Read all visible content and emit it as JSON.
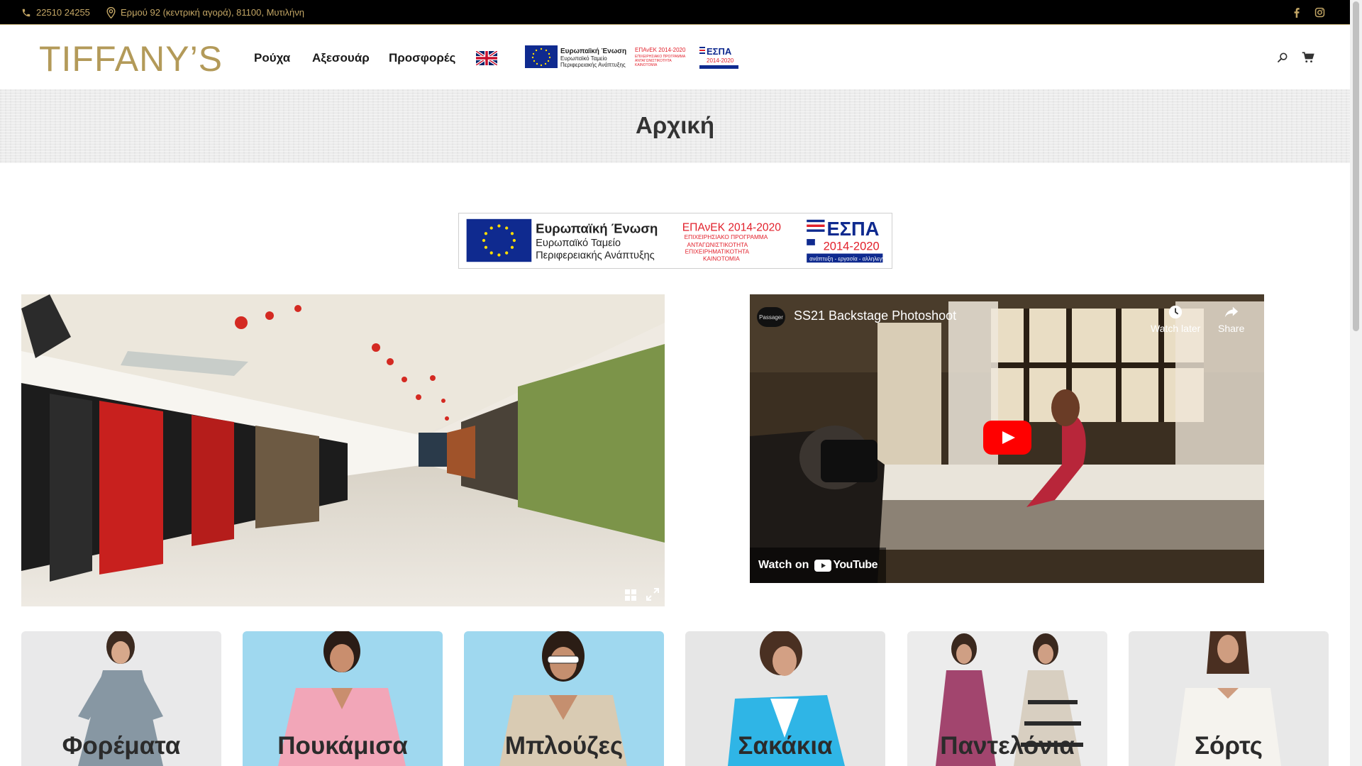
{
  "topbar": {
    "phone": "22510 24255",
    "address": "Ερμού 92 (κεντρική αγορά), 81100, Μυτιλήνη"
  },
  "header": {
    "logo": "TIFFANY’S",
    "nav": [
      {
        "label": "Ρούχα"
      },
      {
        "label": "Αξεσουάρ"
      },
      {
        "label": "Προσφορές"
      }
    ]
  },
  "page": {
    "title": "Αρχική"
  },
  "eu_banner": {
    "eu_title": "Ευρωπαϊκή Ένωση",
    "eu_line1": "Ευρωπαϊκό Ταμείο",
    "eu_line2": "Περιφερειακής Ανάπτυξης",
    "epanek": "ΕΠΑνΕΚ 2014-2020",
    "epanek_line1": "ΕΠΙΧΕΙΡΗΣΙΑΚΟ ΠΡΟΓΡΑΜΜΑ",
    "epanek_line2": "ΑΝΤΑΓΩΝΙΣΤΙΚΟΤΗΤΑ",
    "epanek_line3": "ΕΠΙΧΕΙΡΗΜΑΤΙΚΟΤΗΤΑ",
    "epanek_line4": "ΚΑΙΝΟΤΟΜΙΑ",
    "espa": "ΕΣΠΑ",
    "espa_years": "2014-2020",
    "espa_tag": "ανάπτυξη - εργασία - αλληλεγγύη"
  },
  "video": {
    "channel": "Passager",
    "title": "SS21 Backstage Photoshoot",
    "watch_later": "Watch later",
    "share": "Share",
    "watch_on": "Watch on",
    "youtube": "YouTube"
  },
  "categories": [
    {
      "label": "Φορέματα",
      "bg": "#e9e9ea"
    },
    {
      "label": "Πουκάμισα",
      "bg": "#9fd8ef"
    },
    {
      "label": "Μπλούζες",
      "bg": "#9fd8ef"
    },
    {
      "label": "Σακάκια",
      "bg": "#e6e6e6"
    },
    {
      "label": "Παντελόνια",
      "bg": "#ececec"
    },
    {
      "label": "Σόρτς",
      "bg": "#e8e8e8"
    }
  ],
  "colors": {
    "gold": "#b39a59",
    "topbar": "#000000",
    "eu_blue": "#0f2a8f",
    "espa_red": "#e2202b"
  }
}
